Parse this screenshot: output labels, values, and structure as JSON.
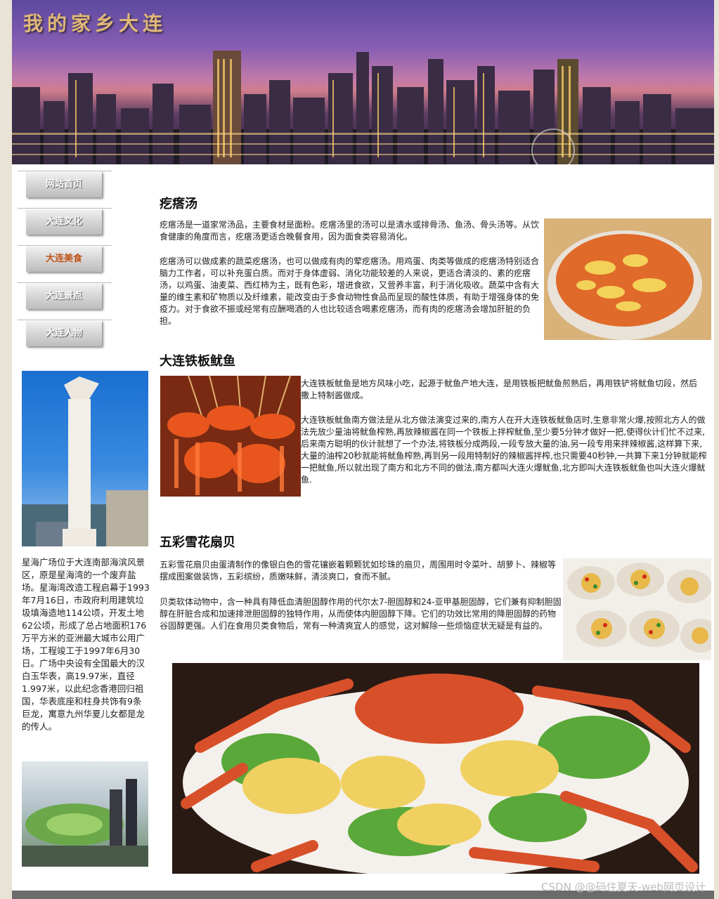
{
  "banner": {
    "title": "我的家乡大连"
  },
  "nav": {
    "items": [
      {
        "label": "网站首页"
      },
      {
        "label": "大连文化"
      },
      {
        "label": "大连美食"
      },
      {
        "label": "大连景点"
      },
      {
        "label": "大连人物"
      }
    ],
    "active_index": 2
  },
  "sidebar": {
    "text": "星海广场位于大连南部海滨风景区，原是星海湾的一个废弃盐场。星海湾改造工程启幕于1993年7月16日，市政府利用建筑垃圾填海造地114公顷，开发土地62公顷，形成了总占地面积176万平方米的亚洲最大城市公用广场，工程竣工于1997年6月30日。广场中央设有全国最大的汉白玉华表，高19.97米，直径1.997米，以此纪念香港回归祖国，华表底座和柱身共饰有9条巨龙，寓意九州华夏儿女都是龙的传人。"
  },
  "sections": {
    "s1": {
      "title": "疙瘩汤",
      "p1": "疙瘩汤是一道家常汤品，主要食材是面粉。疙瘩汤里的汤可以是清水或排骨汤、鱼汤、骨头汤等。从饮食健康的角度而言，疙瘩汤更适合晚餐食用，因为面食类容易消化。",
      "p2": "疙瘩汤可以做成素的蔬菜疙瘩汤，也可以做成有肉的荤疙瘩汤。用鸡蛋、肉类等做成的疙瘩汤特别适合脑力工作者，可以补充蛋白质。而对于身体虚弱、消化功能较差的人来说，更适合清淡的、素的疙瘩汤，以鸡蛋、油麦菜、西红柿为主，既有色彩，增进食欲，又营养丰富，利于消化吸收。蔬菜中含有大量的维生素和矿物质以及纤维素，能改变由于多食动物性食品而呈现的酸性体质，有助于增强身体的免疫力。对于食欲不振或经常有应酬喝酒的人也比较适合喝素疙瘩汤，而有肉的疙瘩汤会增加肝脏的负担。"
    },
    "s2": {
      "title": "大连铁板鱿鱼",
      "p1": "大连铁板鱿鱼是地方风味小吃，起源于鱿鱼产地大连，是用铁板把鱿鱼煎熟后，再用铁铲将鱿鱼切段，然后撒上特制酱做成。",
      "p2": "大连铁板鱿鱼南方做法是从北方做法演变过来的,南方人在开大连铁板鱿鱼店时,生意非常火爆,按照北方人的做法先放少量油将鱿鱼榨熟,再放辣椒酱在同一个铁板上拌榨鱿鱼,至少要5分钟才做好一把,使得伙计们忙不过来,后来南方聪明的伙计就想了一个办法,将铁板分成两段,一段专放大量的油,另一段专用来拌辣椒酱,这样算下来,大量的油榨20秒就能将鱿鱼榨熟,再到另一段用特制好的辣椒酱拌榨,也只需要40秒钟,一共算下来1分钟就能榨一把鱿鱼,所以就出现了南方和北方不同的做法,南方都叫大连火爆鱿鱼,北方即叫大连铁板鱿鱼也叫大连火爆鱿鱼."
    },
    "s3": {
      "title": "五彩雪花扇贝",
      "p1": "五彩雪花扇贝由蛋清制作的像银白色的雪花镶嵌着颗颗犹如珍珠的扇贝，周围用时令菜叶、胡萝卜、辣椒等摆成图案做装饰，五彩缤纷，质嫩味鲜，清淡爽口，食而不腻。",
      "p2": "贝类软体动物中，含一种具有降低血清胆固醇作用的代尔太7-胆固醇和24-亚甲基胆固醇，它们兼有抑制胆固醇在肝脏合成和加速排泄胆固醇的独特作用，从而使体内胆固醇下降。它们的功效比常用的降胆固醇的药物谷固醇更强。人们在食用贝类食物后，常有一种清爽宜人的感觉，这对解除一些烦恼症状无疑是有益的。"
    }
  },
  "watermark": "CSDN @@码住夏天-web网页设计"
}
